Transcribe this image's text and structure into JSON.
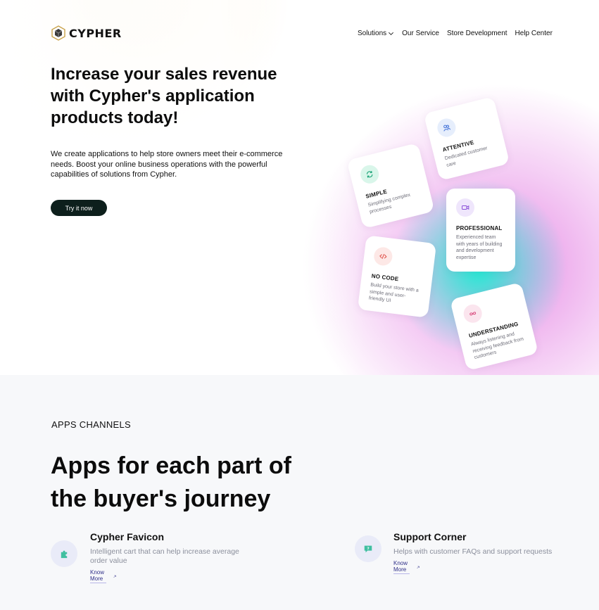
{
  "brand": {
    "name": "CYPHER",
    "logo_icon": "hexagon-cube-logo-icon"
  },
  "nav": {
    "items": [
      {
        "label": "Solutions",
        "has_dropdown": true,
        "icon": "chevron-down-icon"
      },
      {
        "label": "Our Service"
      },
      {
        "label": "Store Development"
      },
      {
        "label": "Help Center"
      }
    ]
  },
  "hero": {
    "title": "Increase your sales revenue with Cypher's application products today!",
    "description": "We create applications to help store owners meet their e-commerce needs. Boost your online business operations with the powerful capabilities of solutions from Cypher.",
    "cta_label": "Try it now"
  },
  "cards": [
    {
      "id": "attentive",
      "title": "ATTENTIVE",
      "subtitle": "Dedicated customer care",
      "icon": "people-icon",
      "icon_color": "#3f6fd8",
      "icon_bg": "#e6eefc"
    },
    {
      "id": "simple",
      "title": "SIMPLE",
      "subtitle": "Simplifying complex processes",
      "icon": "refresh-icon",
      "icon_color": "#1aa377",
      "icon_bg": "#d9f6ea"
    },
    {
      "id": "professional",
      "title": "PROFESSIONAL",
      "subtitle": "Experienced team with years of building and development expertise",
      "icon": "video-camera-icon",
      "icon_color": "#8a4fd8",
      "icon_bg": "#efe6fc"
    },
    {
      "id": "nocode",
      "title": "NO CODE",
      "subtitle": "Build your store with a simple and user-friendly UI",
      "icon": "code-icon",
      "icon_color": "#e0564f",
      "icon_bg": "#fde8e6"
    },
    {
      "id": "understanding",
      "title": "UNDERSTANDING",
      "subtitle": "Always listening and receiving feedback from customers",
      "icon": "infinity-icon",
      "icon_color": "#d8457a",
      "icon_bg": "#fbe5ee"
    }
  ],
  "apps": {
    "eyebrow": "APPS CHANNELS",
    "title": "Apps for each part of the buyer's journey",
    "features": [
      {
        "name": "Cypher Favicon",
        "description": "Intelligent cart that can help increase average order value",
        "link_label": "Know More",
        "icon": "puzzle-icon",
        "icon_color": "#3fbfa0"
      },
      {
        "name": "Support Corner",
        "description": "Helps with customer FAQs and support requests",
        "link_label": "Know More",
        "icon": "chat-question-icon",
        "icon_color": "#3fbfa0"
      }
    ]
  },
  "colors": {
    "cta_bg": "#0d1f1c",
    "accent_yellow": "#f0c86e",
    "accent_pink": "#e278e0",
    "accent_teal": "#14f0d2",
    "section_bg": "#f7f8fa",
    "link": "#2f2f88"
  }
}
